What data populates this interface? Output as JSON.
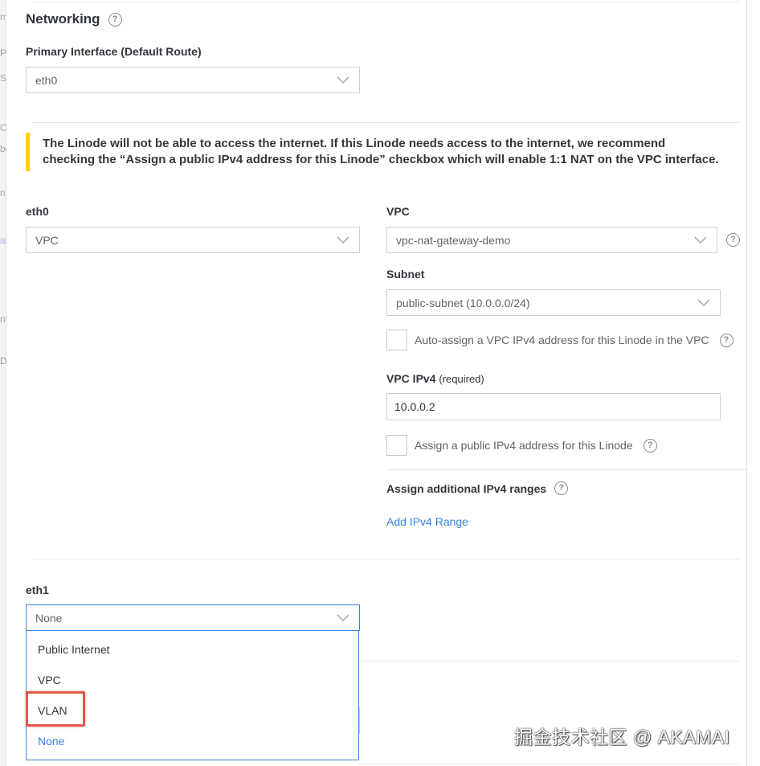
{
  "sidebar_fragments": [
    "m",
    "P",
    "SE",
    "C",
    "be",
    "n",
    "al",
    "nf",
    "D"
  ],
  "networking": {
    "title": "Networking",
    "primary_interface_label": "Primary Interface (Default Route)",
    "primary_interface_value": "eth0"
  },
  "notice": {
    "text": "The Linode will not be able to access the internet. If this Linode needs access to the internet, we recommend checking the “Assign a public IPv4 address for this Linode” checkbox which will enable 1:1 NAT on the VPC interface."
  },
  "eth0": {
    "label": "eth0",
    "value": "VPC"
  },
  "vpc": {
    "label": "VPC",
    "value": "vpc-nat-gateway-demo",
    "subnet_label": "Subnet",
    "subnet_value": "public-subnet (10.0.0.0/24)",
    "auto_assign_label": "Auto-assign a VPC IPv4 address for this Linode in the VPC",
    "ipv4_label": "VPC IPv4",
    "ipv4_required": "(required)",
    "ipv4_value": "10.0.0.2",
    "public_ipv4_label": "Assign a public IPv4 address for this Linode",
    "ranges_label": "Assign additional IPv4 ranges",
    "add_range_link": "Add IPv4 Range"
  },
  "eth1": {
    "label": "eth1",
    "value": "None",
    "options": [
      "Public Internet",
      "VPC",
      "VLAN",
      "None"
    ],
    "selected_option": "None"
  },
  "watermark": "掘金技术社区 @ AKAMAI",
  "colors": {
    "accent": "#3683dc",
    "notice_bar": "#ffd002",
    "highlight_box": "#e4584b"
  }
}
